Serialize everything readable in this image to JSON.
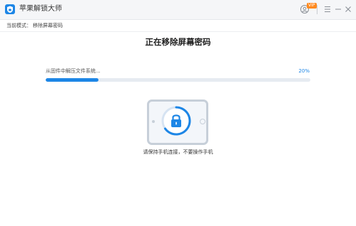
{
  "window": {
    "title": "苹果解锁大师",
    "badge": "VIP"
  },
  "mode": {
    "label": "当前模式：",
    "value": "移除屏幕密码"
  },
  "main": {
    "title": "正在移除屏幕密码",
    "progress_text": "从固件中解压文件系统...",
    "progress_percent_text": "20%",
    "progress_value": 0.2,
    "hint": "请保持手机连接，不要操作手机"
  },
  "colors": {
    "accent": "#1d86e6",
    "track": "#e6ebf1"
  },
  "icons": {
    "app": "app-logo-icon",
    "user": "user-avatar-icon",
    "menu": "menu-icon",
    "minimize": "minimize-icon",
    "close": "close-icon",
    "lock": "lock-icon"
  }
}
